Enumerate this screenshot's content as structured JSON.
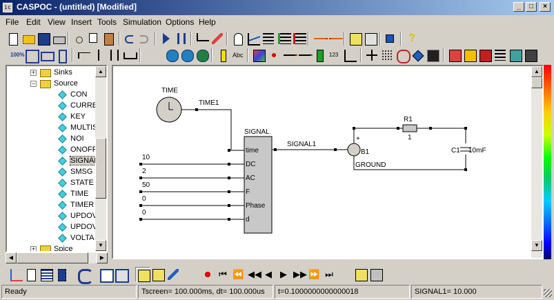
{
  "window": {
    "title": "CASPOC - (untitled) [Modified]",
    "app_icon": "caspoc-app-icon",
    "buttons": {
      "minimize": "_",
      "maximize": "□",
      "close": "×"
    }
  },
  "menu": [
    "File",
    "Edit",
    "View",
    "Insert",
    "Tools",
    "Simulation",
    "Options",
    "Help"
  ],
  "toolbar1": [
    "new-file-icon",
    "open-folder-icon",
    "save-icon",
    "print-icon",
    "cut-icon",
    "copy-icon",
    "paste-icon",
    "undo-icon",
    "redo-icon",
    "run-icon",
    "pause-icon",
    "library-icon",
    "pencil-icon",
    "hand-icon",
    "scope-icon",
    "list-icon",
    "list-check-icon",
    "list-x-icon",
    "arrow-right-icon",
    "arrow-left-icon",
    "component-a-icon",
    "component-b-icon",
    "export-icon",
    "help-icon"
  ],
  "toolbar2": [
    "zoom-100-icon",
    "zoom-fit-icon",
    "zoom-width-icon",
    "zoom-height-icon",
    "align-a-icon",
    "align-b-icon",
    "align-c-icon",
    "align-d-icon",
    "globe-a-icon",
    "globe-b-icon",
    "globe-c-icon",
    "probe-icon",
    "funnel-icon",
    "text-abc-icon",
    "color-icon",
    "node-icon",
    "arrow-r-icon",
    "arrow-r2-icon",
    "block-icon",
    "counter-123-icon",
    "chart-icon",
    "cross-icon",
    "grid-icon",
    "clock-icon",
    "paint-icon",
    "dark-icon",
    "frame-a-icon",
    "frame-b-icon",
    "frame-c-icon",
    "list-sort-icon",
    "grid-b-icon",
    "grid-c-icon"
  ],
  "tree": {
    "items": [
      {
        "label": "Sinks",
        "kind": "folder"
      },
      {
        "label": "Source",
        "kind": "folder-open"
      },
      {
        "label": "CON",
        "kind": "leaf"
      },
      {
        "label": "CURRE",
        "kind": "leaf"
      },
      {
        "label": "KEY",
        "kind": "leaf"
      },
      {
        "label": "MULTIS",
        "kind": "leaf"
      },
      {
        "label": "NOI",
        "kind": "leaf"
      },
      {
        "label": "ONOFF",
        "kind": "leaf"
      },
      {
        "label": "SIGNAL",
        "kind": "leaf",
        "selected": true
      },
      {
        "label": "SMSG",
        "kind": "leaf"
      },
      {
        "label": "STATE",
        "kind": "leaf"
      },
      {
        "label": "TIME",
        "kind": "leaf"
      },
      {
        "label": "TIMER",
        "kind": "leaf"
      },
      {
        "label": "UPDOV",
        "kind": "leaf"
      },
      {
        "label": "UPDOV",
        "kind": "leaf"
      },
      {
        "label": "VOLTA",
        "kind": "leaf"
      },
      {
        "label": "Spice",
        "kind": "folder"
      }
    ]
  },
  "schematic": {
    "time_block": {
      "label": "TIME",
      "output": "TIME1"
    },
    "signal_block": {
      "label": "SIGNAL",
      "output": "SIGNAL1",
      "ports": [
        "time",
        "DC",
        "AC",
        "F",
        "Phase",
        "d"
      ],
      "inputs": [
        "10",
        "2",
        "50",
        "0",
        "0"
      ]
    },
    "source": {
      "label": "B1",
      "ground": "GROUND",
      "plus": "+"
    },
    "resistor": {
      "label": "R1",
      "value": "1"
    },
    "capacitor": {
      "label": "C1",
      "value": "10mF"
    }
  },
  "bottom_toolbar": [
    "graph-icon",
    "document-icon",
    "table-icon",
    "chip-icon",
    "refresh-icon",
    "netlist-a-icon",
    "netlist-b-icon",
    "scope-a-icon",
    "scope-b-icon",
    "pencil-b-icon",
    "record-icon",
    "first-icon",
    "fast-back-icon",
    "step-back-icon",
    "back-icon",
    "play-icon",
    "forward-icon",
    "fast-forward-icon",
    "last-icon",
    "window-a-icon",
    "window-b-icon"
  ],
  "status": {
    "ready": "Ready",
    "tscreen": "Tscreen= 100.000ms, dt= 100.000us",
    "time": "t=0.1000000000000018",
    "signal": "SIGNAL1= 10.000"
  }
}
